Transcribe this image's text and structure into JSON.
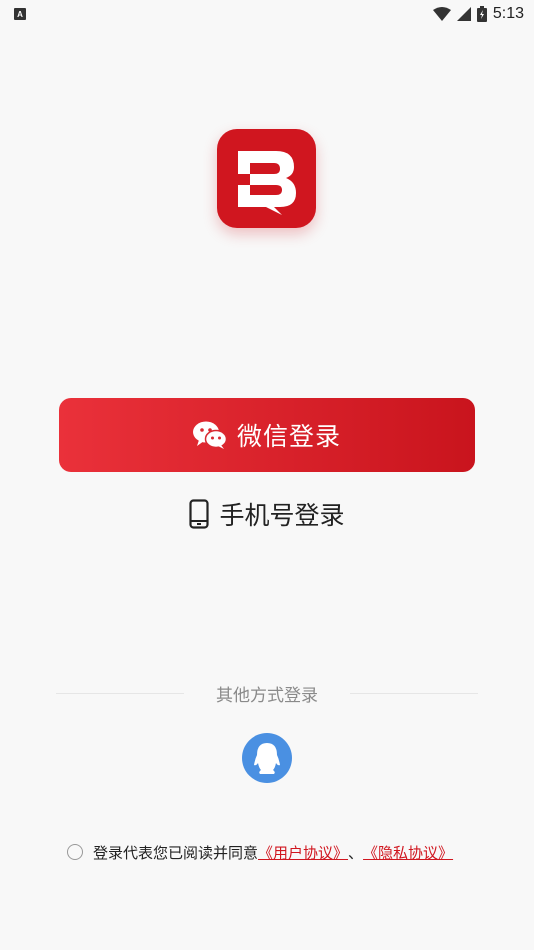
{
  "status_bar": {
    "notification_icon": "A",
    "time": "5:13",
    "icons": [
      "wifi-icon",
      "signal-icon",
      "battery-icon"
    ]
  },
  "brand": {
    "logo_icon": "brand-b-logo-icon",
    "accent_color": "#d0161f"
  },
  "login": {
    "wechat_label": "微信登录",
    "wechat_icon": "wechat-icon",
    "phone_label": "手机号登录",
    "phone_icon": "phone-icon"
  },
  "other": {
    "divider_label": "其他方式登录",
    "qq_icon": "qq-icon"
  },
  "agreement": {
    "prefix": "登录代表您已阅读并同意",
    "user_agreement": "《用户协议》",
    "separator": "、",
    "privacy_policy": "《隐私协议》"
  }
}
